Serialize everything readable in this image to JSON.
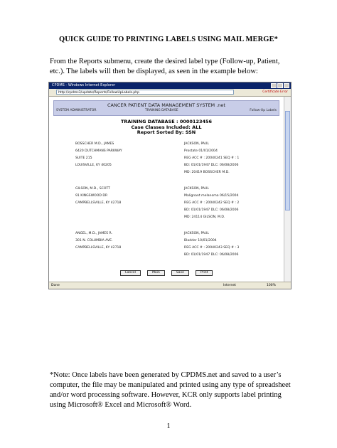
{
  "document": {
    "title": "QUICK GUIDE TO PRINTING LABELS USING MAIL MERGE*",
    "intro": "From the Reports submenu, create the desired label type (Follow-up, Patient, etc.).  The labels will then be displayed, as seen in the example below:",
    "note": "*Note:  Once labels have been generated by CPDMS.net and saved to a user’s computer, the file may be manipulated and printed using any type of spreadsheet and/or word processing software.  However, KCR only supports label printing using Microsoft® Excel and Microsoft® Word.",
    "page_number": "1"
  },
  "browser": {
    "window_title": "CPDMS - Windows Internet Explorer",
    "address": "http://cpdms3/update/Reports/FollowUpLabels.php",
    "certificate": "Certificate Error",
    "status": "Done",
    "zone": "Internet",
    "zoom": "100%"
  },
  "app": {
    "title": "CANCER PATIENT DATA MANAGEMENT SYSTEM .net",
    "user": "SYSTEM ADMINISTRATOR",
    "database": "TRAINING DATABASE",
    "page": "Follow-Up Labels"
  },
  "report": {
    "line1": "TRAINING DATABASE : 0000123456",
    "line2": "Case Classes Included: ALL",
    "line3": "Report Sorted By: SSN"
  },
  "records": [
    {
      "physician": [
        "BOSSCHER M.D., JAMES",
        "6420 DUTCHMANS PARKWAY",
        "SUITE 215",
        "LOUISVILLE, KY 40205"
      ],
      "patient": [
        "JACKSON, PAUL",
        "Prostate 01/01/2004",
        "REG ACC # : 20040241 SEQ # : 1",
        "BD: 01/01/1947 DLC: 06/08/2006",
        "MD: 20419 BOSSCHER M.D."
      ]
    },
    {
      "physician": [
        "GILSON, M.D., SCOTT",
        "91 KINGSWOOD DR",
        "CAMPBELLSVILLE, KY 42718"
      ],
      "patient": [
        "JACKSON, PAUL",
        "Malignant melanoma 06/15/2004",
        "REG ACC # : 20040242 SEQ # : 2",
        "BD: 01/01/1947 DLC: 06/08/2006",
        "MD: 24114 GILSON, M.D."
      ]
    },
    {
      "physician": [
        "ANGEL, M.D., JAMES R.",
        "301 N. COLUMBIA AVE.",
        "CAMPBELLSVILLE, KY 42718"
      ],
      "patient": [
        "JACKSON, PAUL",
        "Bladder 10/01/2004",
        "REG ACC # : 20040243 SEQ # : 3",
        "BD: 01/01/1947 DLC: 06/08/2006"
      ]
    }
  ],
  "buttons": {
    "cancel": "Cancel",
    "main": "Main",
    "save": "Save",
    "print": "Print"
  }
}
